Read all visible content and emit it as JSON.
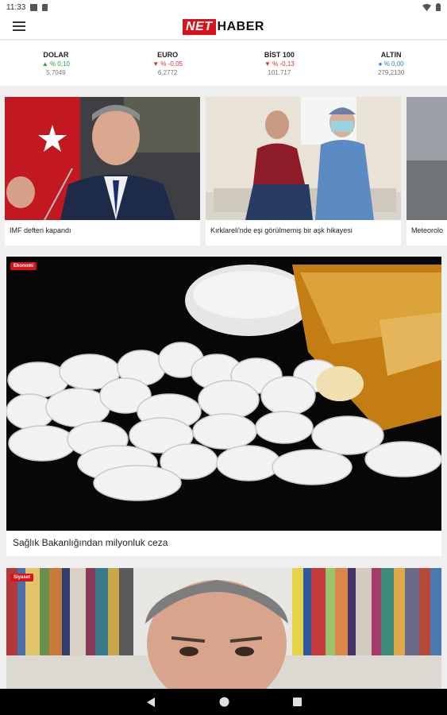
{
  "status": {
    "time": "11:33"
  },
  "brand": {
    "net": "NET",
    "haber": "HABER"
  },
  "ticker": [
    {
      "name": "DOLAR",
      "arrow": "▲",
      "change": "% 0,10",
      "value": "5,7049",
      "trend": "up"
    },
    {
      "name": "EURO",
      "arrow": "▼",
      "change": "% -0,05",
      "value": "6,2772",
      "trend": "down"
    },
    {
      "name": "BİST 100",
      "arrow": "▼",
      "change": "% -0,13",
      "value": "101.717",
      "trend": "down"
    },
    {
      "name": "ALTIN",
      "arrow": "●",
      "change": "% 0,00",
      "value": "279,2130",
      "trend": "flat"
    }
  ],
  "carousel": [
    {
      "caption": "IMF defteri kapandı"
    },
    {
      "caption": "Kırklareli'nde eşi görülmemiş bir aşk hikayesi"
    },
    {
      "caption": "Meteorolo"
    }
  ],
  "featured": [
    {
      "badge": "Ekonomi",
      "caption": "Sağlık Bakanlığından milyonluk ceza"
    },
    {
      "badge": "Siyaset",
      "caption": ""
    }
  ],
  "colors": {
    "brand_red": "#d7141b",
    "up": "#27a035",
    "down": "#e02a2a",
    "flat": "#2b78d6"
  }
}
